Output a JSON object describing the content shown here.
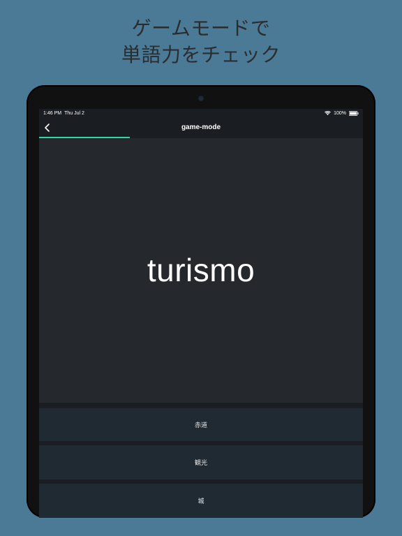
{
  "promo": {
    "line1": "ゲームモードで",
    "line2": "単語力をチェック"
  },
  "status": {
    "time": "1:46 PM",
    "date": "Thu Jul 2",
    "battery": "100%"
  },
  "nav": {
    "title": "game-mode"
  },
  "progress": {
    "percent": 28
  },
  "question": {
    "word": "turismo"
  },
  "answers": [
    {
      "label": "赤道"
    },
    {
      "label": "観光"
    },
    {
      "label": "城"
    }
  ],
  "colors": {
    "background": "#4a7a96",
    "accent": "#2dd8a3",
    "screen": "#1f2428",
    "card": "#25292e",
    "answer": "#1f2a33"
  }
}
